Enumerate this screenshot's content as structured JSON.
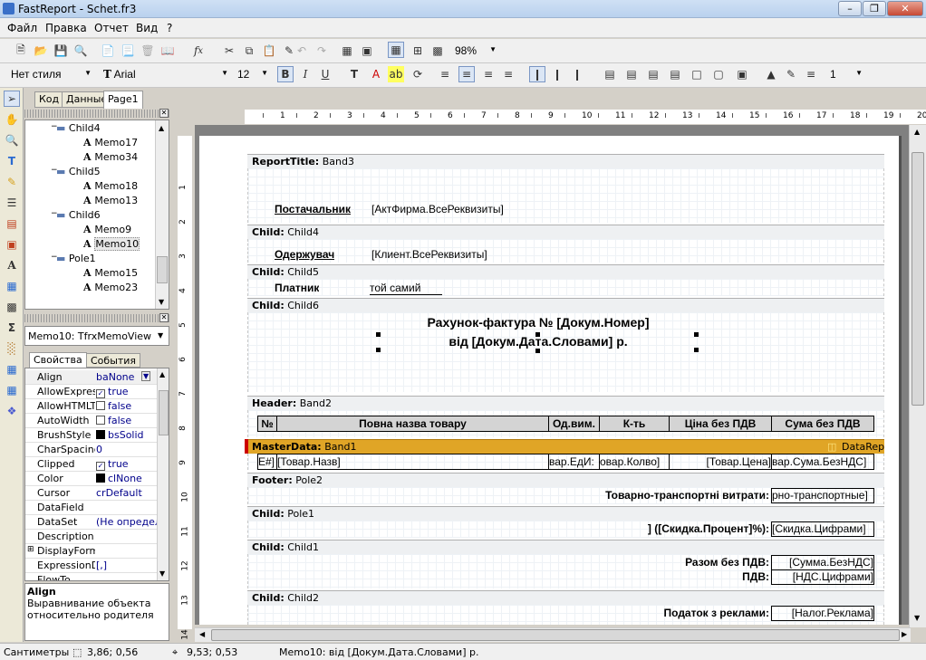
{
  "window": {
    "title": "FastReport - Schet.fr3"
  },
  "menu": [
    "Файл",
    "Правка",
    "Отчет",
    "Вид",
    "?"
  ],
  "toolbar": {
    "zoom": "98%",
    "style": "Нет стиля",
    "font": "Arial",
    "font_size": "12",
    "bold": "B",
    "italic": "I",
    "underline": "U",
    "frame_width": "1"
  },
  "tabs": [
    "Код",
    "Данные",
    "Page1"
  ],
  "tree": [
    {
      "label": "Child4",
      "type": "band",
      "level": 1
    },
    {
      "label": "Memo17",
      "type": "memo",
      "level": 2
    },
    {
      "label": "Memo34",
      "type": "memo",
      "level": 2
    },
    {
      "label": "Child5",
      "type": "band",
      "level": 1
    },
    {
      "label": "Memo18",
      "type": "memo",
      "level": 2
    },
    {
      "label": "Memo13",
      "type": "memo",
      "level": 2
    },
    {
      "label": "Child6",
      "type": "band",
      "level": 1
    },
    {
      "label": "Memo9",
      "type": "memo",
      "level": 2
    },
    {
      "label": "Memo10",
      "type": "memo",
      "level": 2,
      "selected": true
    },
    {
      "label": "Pole1",
      "type": "band",
      "level": 1
    },
    {
      "label": "Memo15",
      "type": "memo",
      "level": 2
    },
    {
      "label": "Memo23",
      "type": "memo",
      "level": 2
    }
  ],
  "object_selector": "Memo10: TfrxMemoView",
  "inspector_tabs": [
    "Свойства",
    "События"
  ],
  "properties": [
    {
      "name": "Align",
      "value": "baNone",
      "dropdown": true,
      "bold": false
    },
    {
      "name": "AllowExpress",
      "value": "true",
      "checked": true
    },
    {
      "name": "AllowHTMLTa",
      "value": "false",
      "checked": false
    },
    {
      "name": "AutoWidth",
      "value": "false",
      "checked": false
    },
    {
      "name": "BrushStyle",
      "value": "bsSolid",
      "swatch": true
    },
    {
      "name": "CharSpacing",
      "value": "0"
    },
    {
      "name": "Clipped",
      "value": "true",
      "checked": true
    },
    {
      "name": "Color",
      "value": "clNone",
      "swatch": true
    },
    {
      "name": "Cursor",
      "value": "crDefault"
    },
    {
      "name": "DataField",
      "value": ""
    },
    {
      "name": "DataSet",
      "value": "(Не определ"
    },
    {
      "name": "Description",
      "value": ""
    },
    {
      "name": "DisplayForma",
      "value": "",
      "expand": true
    },
    {
      "name": "ExpressionDe",
      "value": "[,]"
    },
    {
      "name": "FlowTo",
      "value": ""
    }
  ],
  "help": {
    "title": "Align",
    "text": "Выравнивание объекта относительно родителя"
  },
  "ruler": {
    "h": [
      "1",
      "2",
      "3",
      "4",
      "5",
      "6",
      "7",
      "8",
      "9",
      "10",
      "11",
      "12",
      "13",
      "14",
      "15",
      "16",
      "17",
      "18",
      "19",
      "20"
    ],
    "v": [
      "1",
      "2",
      "3",
      "4",
      "5",
      "6",
      "7",
      "8",
      "9",
      "10",
      "11",
      "12",
      "13",
      "14"
    ]
  },
  "bands": {
    "report_title": {
      "label": "ReportTitle:",
      "name": "Band3"
    },
    "child4": {
      "label": "Child:",
      "name": "Child4"
    },
    "child5": {
      "label": "Child:",
      "name": "Child5"
    },
    "child6": {
      "label": "Child:",
      "name": "Child6"
    },
    "header": {
      "label": "Header:",
      "name": "Band2"
    },
    "masterdata": {
      "label": "MasterData:",
      "name": "Band1",
      "dataset": "DataRep"
    },
    "footer": {
      "label": "Footer:",
      "name": "Pole2"
    },
    "pole1": {
      "label": "Child:",
      "name": "Pole1"
    },
    "child1": {
      "label": "Child:",
      "name": "Child1"
    },
    "child2": {
      "label": "Child:",
      "name": "Child2"
    }
  },
  "report": {
    "supplier_label": "Постачальник",
    "supplier_value": "[АктФирма.ВсеРеквизиты]",
    "recipient_label": "Одержувач",
    "recipient_value": "[Клиент.ВсеРеквизиты]",
    "payer_label": "Платник",
    "payer_value": "той самий",
    "invoice_line1": "Рахунок-фактура № [Докум.Номер]",
    "invoice_line2": "від [Докум.Дата.Словами] р.",
    "columns": [
      "№",
      "Повна назва товару",
      "Од.вим.",
      "К-ть",
      "Ціна без ПДВ",
      "Сума без ПДВ"
    ],
    "row": [
      "E#]",
      "[Товар.Назв]",
      "вар.ЕдИ:",
      "овар.Колво]",
      "[Товар.Цена]",
      "вар.Сума.БезНДС]"
    ],
    "transport_label": "Товарно-транспортні витрати:",
    "transport_value": "рно-транспортные]",
    "discount_label": "] ([Скидка.Процент]%):",
    "discount_value": "[Скидка.Цифрами]",
    "total_label": "Разом без ПДВ:",
    "total_value": "[Сумма.БезНДС]",
    "vat_label": "ПДВ:",
    "vat_value": "[НДС.Цифрами]",
    "ad_tax_label": "Податок з реклами:",
    "ad_tax_value": "[Налог.Реклама]"
  },
  "status": {
    "units": "Сантиметры",
    "position": "3,86; 0,56",
    "size": "9,53; 0,53",
    "object": "Memo10: від [Докум.Дата.Словами] р."
  },
  "colors": {
    "masterdata": "#e0a526",
    "selection": "#316ac5"
  }
}
